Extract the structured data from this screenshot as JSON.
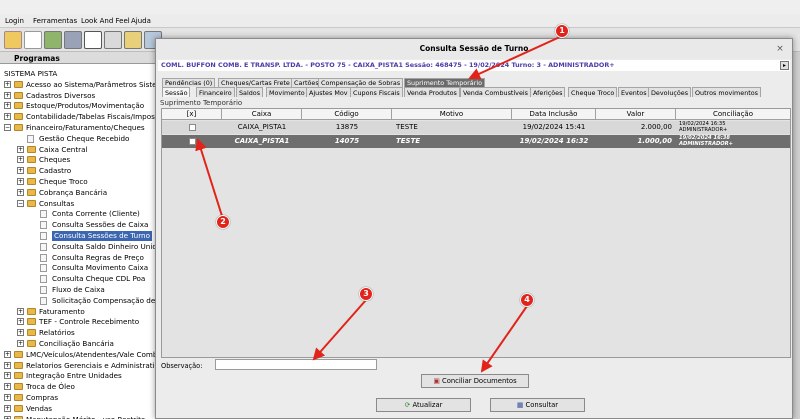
{
  "menu": [
    "Login",
    "Ferramentas",
    "Look And Feel",
    "Ajuda"
  ],
  "left_panel": {
    "title": "Programas",
    "items": [
      "SISTEMA PISTA",
      "Acesso ao Sistema/Parâmetros Sister",
      "Cadastros Diversos",
      "Estoque/Produtos/Movimentação",
      "Contabilidade/Tabelas Fiscais/Imposto",
      "Financeiro/Faturamento/Cheques",
      "Gestão Cheque Recebido",
      "Caixa Central",
      "Cheques",
      "Cadastro",
      "Cheque Troco",
      "Cobrança Bancária",
      "Consultas",
      "Conta Corrente (Cliente)",
      "Consulta Sessões de Caixa",
      "Consulta Sessões de Turno",
      "Consulta Saldo Dinheiro Unidad",
      "Consulta Regras de Preço",
      "Consulta Movimento Caixa",
      "Consulta Cheque CDL Poa",
      "Fluxo de Caixa",
      "Solicitação Compensação de So",
      "Faturamento",
      "TEF - Controle Recebimento",
      "Relatórios",
      "Conciliação Bancária",
      "LMC/Veículos/Atendentes/Vale Combu",
      "Relatorios Gerenciais e Administrativo",
      "Integração Entre Unidades",
      "Troca de Óleo",
      "Compras",
      "Vendas",
      "Manutenção Mérito - uso Restrito"
    ]
  },
  "dialog": {
    "title": "Consulta Sessão de Turno",
    "info": "COML. BUFFON COMB. E TRANSP. LTDA. - POSTO 75 - CAIXA_PISTA1   Sessão: 468475 - 19/02/2024 Turno: 3 - ADMINISTRADOR+",
    "tabs_row1": [
      "Pendências (0)",
      "Cheques/Cartas Frete",
      "Cartões",
      "Compensação de Sobras",
      "Suprimento Temporário"
    ],
    "tabs_row2": [
      "Sessão",
      "Financeiro",
      "Saldos",
      "Movimento",
      "Ajustes Mov",
      "Cupons Fiscais",
      "Venda Produtos",
      "Venda Combustíveis",
      "Aferições",
      "Cheque Troco",
      "Eventos",
      "Devoluções",
      "Outros movimentos"
    ],
    "section_label": "Suprimento Temporário",
    "columns": [
      "[x]",
      "Caixa",
      "Código",
      "Motivo",
      "Data Inclusão",
      "Valor",
      "Conciliação"
    ],
    "rows": [
      {
        "caixa": "CAIXA_PISTA1",
        "codigo": "13875",
        "motivo": "TESTE",
        "data": "19/02/2024 15:41",
        "valor": "2.000,00",
        "conc1": "19/02/2024 16:35",
        "conc2": "ADMINISTRADOR+"
      },
      {
        "caixa": "CAIXA_PISTA1",
        "codigo": "14075",
        "motivo": "TESTE",
        "data": "19/02/2024 16:32",
        "valor": "1.000,00",
        "conc1": "19/02/2024 16:38",
        "conc2": "ADMINISTRADOR+"
      }
    ],
    "obs_label": "Observação:",
    "conciliar_label": "Conciliar Documentos",
    "atualizar_label": "Atualizar",
    "consultar_label": "Consultar"
  },
  "annotations": [
    "1",
    "2",
    "3",
    "4"
  ],
  "colors": {
    "annotation": "#e2231a",
    "info_text": "#4b3ba8",
    "selected_row": "#6e6e6e"
  }
}
